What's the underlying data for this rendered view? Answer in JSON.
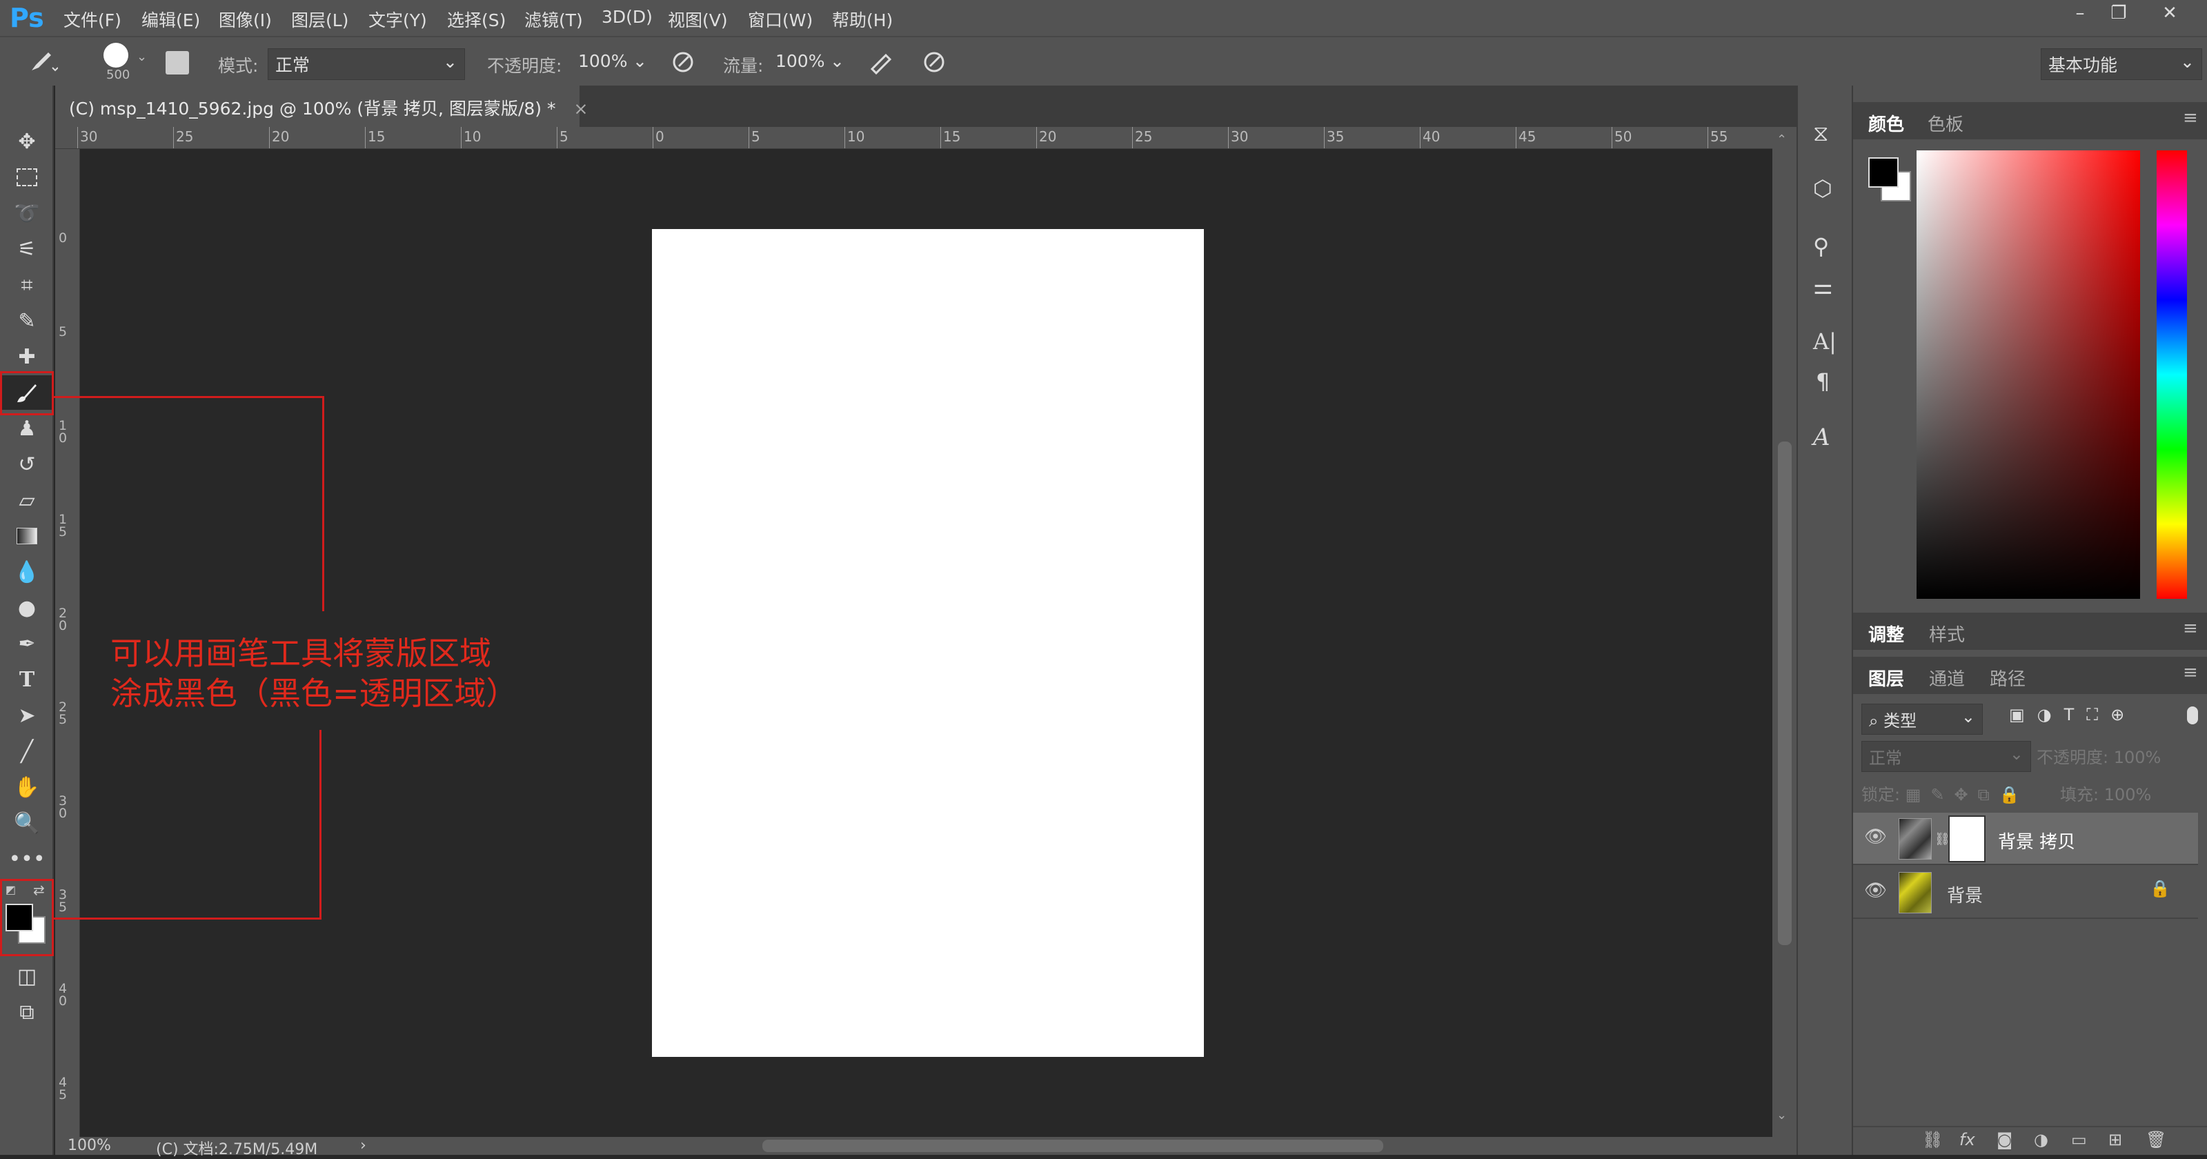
{
  "app": {
    "logo": "Ps"
  },
  "menu": [
    "文件(F)",
    "编辑(E)",
    "图像(I)",
    "图层(L)",
    "文字(Y)",
    "选择(S)",
    "滤镜(T)",
    "3D(D)",
    "视图(V)",
    "窗口(W)",
    "帮助(H)"
  ],
  "window_controls": {
    "minimize": "–",
    "restore": "❐",
    "close": "✕"
  },
  "options": {
    "brush_size": "500",
    "mode_label": "模式:",
    "mode_value": "正常",
    "opacity_label": "不透明度:",
    "opacity_value": "100%",
    "flow_label": "流量:",
    "flow_value": "100%",
    "workspace": "基本功能"
  },
  "document_tab": {
    "title": "(C) msp_1410_5962.jpg @ 100% (背景 拷贝, 图层蒙版/8) *",
    "close": "×"
  },
  "ruler_top": [
    "30",
    "25",
    "20",
    "15",
    "10",
    "5",
    "0",
    "5",
    "10",
    "15",
    "20",
    "25",
    "30",
    "35",
    "40",
    "45",
    "50",
    "55"
  ],
  "ruler_left": [
    "0",
    "5",
    "1 0",
    "1 5",
    "2 0",
    "2 5",
    "3 0",
    "3 5",
    "4 0",
    "4 5"
  ],
  "status": {
    "zoom": "100%",
    "doc": "(C) 文档:2.75M/5.49M",
    "arrow": "›"
  },
  "annotation": {
    "line1": "可以用画笔工具将蒙版区域",
    "line2": "涂成黑色（黑色=透明区域）"
  },
  "color_panel": {
    "tabs": [
      "颜色",
      "色板"
    ]
  },
  "adjust_panel": {
    "tabs": [
      "调整",
      "样式"
    ]
  },
  "layers_panel": {
    "tabs": [
      "图层",
      "通道",
      "路径"
    ],
    "filter": "类型",
    "blend_mode": "正常",
    "opacity_label": "不透明度:",
    "opacity_value": "100%",
    "lock_label": "锁定:",
    "fill_label": "填充:",
    "fill_value": "100%",
    "layers": [
      {
        "name": "背景 拷贝",
        "selected": true
      },
      {
        "name": "背景",
        "selected": false
      }
    ]
  },
  "colors": {
    "accent": "#31a8ff",
    "annotation": "#e0291c",
    "foreground": "#000000",
    "background": "#ffffff"
  }
}
